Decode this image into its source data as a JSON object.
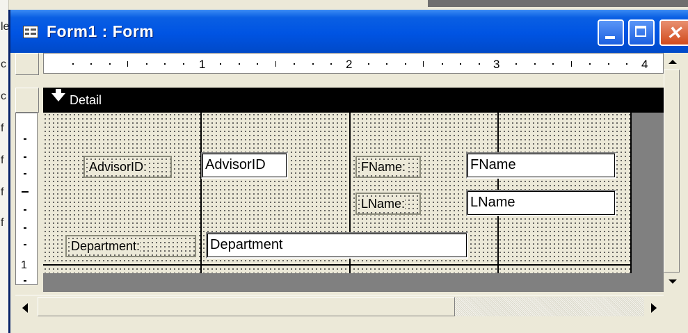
{
  "background": {
    "left_chars": [
      "le",
      "c",
      "c",
      "f",
      "f",
      "f",
      "f"
    ]
  },
  "window": {
    "title": "Form1 : Form",
    "icon": "form-icon"
  },
  "titlebar_buttons": {
    "minimize": "minimize-icon",
    "maximize": "maximize-icon",
    "close": "close-icon"
  },
  "ruler": {
    "numbers": [
      "1",
      "2",
      "3",
      "4"
    ],
    "vertical_number": "1"
  },
  "section": {
    "label": "Detail",
    "icon": "section-arrow-icon"
  },
  "controls": {
    "advisor_label": "AdvisorID:",
    "advisor_field": "AdvisorID",
    "fname_label": "FName:",
    "fname_field": "FName",
    "lname_label": "LName:",
    "lname_field": "LName",
    "department_label": "Department:",
    "department_field": "Department"
  },
  "colors": {
    "titlebar": "#0054e3",
    "close_button": "#d14a1c",
    "design_surface": "#ece9d8",
    "section_bar": "#000000"
  }
}
